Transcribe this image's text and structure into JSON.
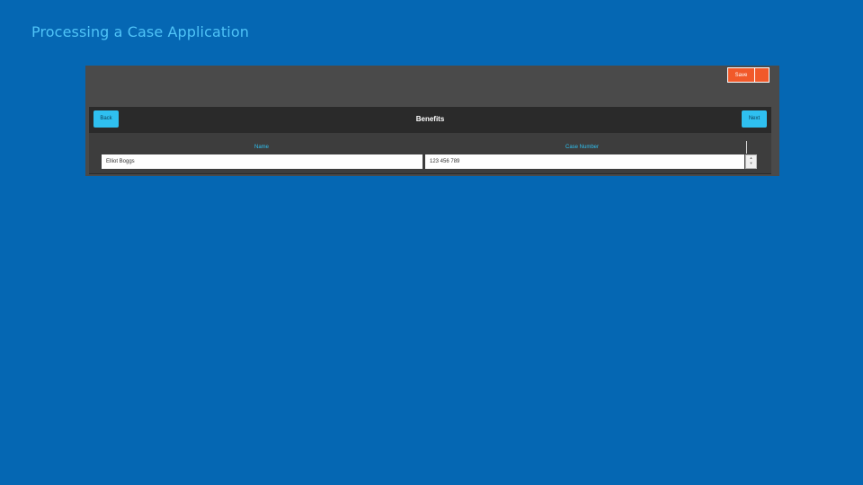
{
  "slide": {
    "title": "Processing a Case Application"
  },
  "toolbar": {
    "save_label": "Save"
  },
  "nav": {
    "back_label": "Back",
    "title": "Benefits",
    "next_label": "Next"
  },
  "table": {
    "columns": [
      "Name",
      "Case Number"
    ],
    "rows": [
      {
        "name": "Elliot Boggs",
        "case_number": "123 456 789"
      }
    ]
  },
  "colors": {
    "background": "#0567b3",
    "accent": "#2fc0f0",
    "save": "#f1592a"
  }
}
